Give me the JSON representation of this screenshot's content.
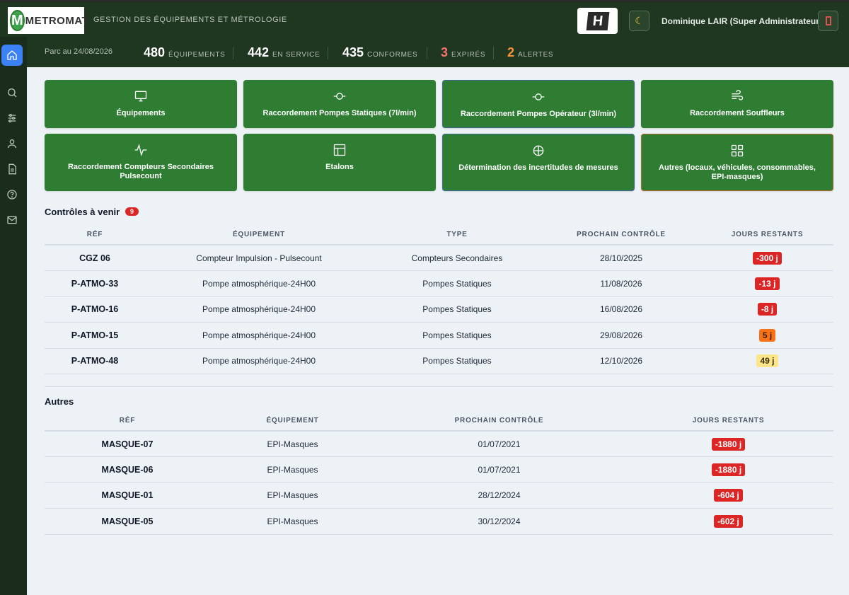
{
  "header": {
    "logo_letter": "M",
    "logo_text": "METROMAT",
    "subtitle": "GESTION DES ÉQUIPEMENTS ET MÉTROLOGIE",
    "badge_letter": "H",
    "user": "Dominique LAIR (Super Administrateur)"
  },
  "stats": {
    "parc": "Parc au 24/08/2026",
    "items": [
      {
        "num": "480",
        "label": "ÉQUIPEMENTS"
      },
      {
        "num": "442",
        "label": "EN SERVICE"
      },
      {
        "num": "435",
        "label": "CONFORMES"
      },
      {
        "num": "3",
        "label": "EXPIRÉS"
      },
      {
        "num": "2",
        "label": "ALERTES"
      }
    ]
  },
  "tiles": [
    {
      "label": "Équipements",
      "icon": "monitor-icon"
    },
    {
      "label": "Raccordement Pompes Statiques (7l/min)",
      "icon": "pump-icon"
    },
    {
      "label": "Raccordement Pompes Opérateur (3l/min)",
      "icon": "pump-icon"
    },
    {
      "label": "Raccordement Souffleurs",
      "icon": "wind-icon"
    },
    {
      "label": "Raccordement Compteurs Secondaires Pulsecount",
      "icon": "pulse-icon"
    },
    {
      "label": "Etalons",
      "icon": "table-icon"
    },
    {
      "label": "Détermination des incertitudes de mesures",
      "icon": "crosshair-icon"
    },
    {
      "label": "Autres (locaux, véhicules, consommables, EPI-masques)",
      "icon": "grid-icon"
    }
  ],
  "upcoming": {
    "title": "Contrôles à venir",
    "count": "9",
    "columns": [
      "RÉF",
      "ÉQUIPEMENT",
      "TYPE",
      "PROCHAIN CONTRÔLE",
      "JOURS RESTANTS"
    ],
    "rows": [
      {
        "ref": "CGZ 06",
        "equip": "Compteur Impulsion - Pulsecount",
        "type": "Compteurs Secondaires",
        "date": "28/10/2025",
        "days": "-300 j",
        "level": "red"
      },
      {
        "ref": "P-ATMO-33",
        "equip": "Pompe atmosphérique-24H00",
        "type": "Pompes Statiques",
        "date": "11/08/2026",
        "days": "-13 j",
        "level": "red"
      },
      {
        "ref": "P-ATMO-16",
        "equip": "Pompe atmosphérique-24H00",
        "type": "Pompes Statiques",
        "date": "16/08/2026",
        "days": "-8 j",
        "level": "red"
      },
      {
        "ref": "P-ATMO-15",
        "equip": "Pompe atmosphérique-24H00",
        "type": "Pompes Statiques",
        "date": "29/08/2026",
        "days": "5 j",
        "level": "orange"
      },
      {
        "ref": "P-ATMO-48",
        "equip": "Pompe atmosphérique-24H00",
        "type": "Pompes Statiques",
        "date": "12/10/2026",
        "days": "49 j",
        "level": "yellow"
      }
    ]
  },
  "others": {
    "title": "Autres",
    "columns": [
      "RÉF",
      "ÉQUIPEMENT",
      "PROCHAIN CONTRÔLE",
      "JOURS RESTANTS"
    ],
    "rows": [
      {
        "ref": "MASQUE-07",
        "equip": "EPI-Masques",
        "date": "01/07/2021",
        "days": "-1880 j",
        "level": "red"
      },
      {
        "ref": "MASQUE-06",
        "equip": "EPI-Masques",
        "date": "01/07/2021",
        "days": "-1880 j",
        "level": "red"
      },
      {
        "ref": "MASQUE-01",
        "equip": "EPI-Masques",
        "date": "28/12/2024",
        "days": "-604 j",
        "level": "red"
      },
      {
        "ref": "MASQUE-05",
        "equip": "EPI-Masques",
        "date": "30/12/2024",
        "days": "-602 j",
        "level": "red"
      }
    ]
  },
  "sidebar": [
    "home-icon",
    "search-icon",
    "sliders-icon",
    "user-icon",
    "document-icon",
    "help-icon",
    "mail-icon"
  ],
  "colors": {
    "brand_dark": "#1f3621",
    "tile_green": "#2e7d32",
    "accent_blue": "#3b82f6",
    "danger": "#dc2626",
    "warning": "#f97316"
  }
}
